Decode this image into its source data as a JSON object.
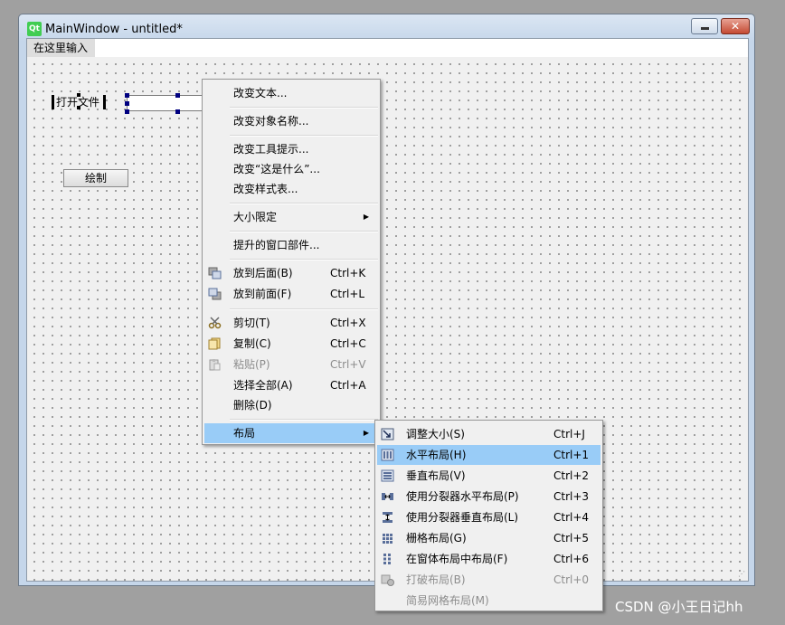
{
  "window": {
    "title": "MainWindow - untitled*",
    "logo_text": "Qt",
    "close_glyph": "✕"
  },
  "menubar": {
    "placeholder": "在这里输入"
  },
  "form": {
    "label_open_file": "打开文件",
    "button_draw": "绘制"
  },
  "context_menu": {
    "items": [
      {
        "label": "改变文本..."
      },
      {
        "label": "改变对象名称..."
      },
      {
        "label": "改变工具提示..."
      },
      {
        "label": "改变“这是什么”..."
      },
      {
        "label": "改变样式表..."
      },
      {
        "label": "大小限定",
        "submenu": true
      },
      {
        "label": "提升的窗口部件..."
      },
      {
        "label": "放到后面(B)",
        "shortcut": "Ctrl+K",
        "icon": "send-to-back-icon"
      },
      {
        "label": "放到前面(F)",
        "shortcut": "Ctrl+L",
        "icon": "bring-to-front-icon"
      },
      {
        "label": "剪切(T)",
        "shortcut": "Ctrl+X",
        "icon": "cut-icon"
      },
      {
        "label": "复制(C)",
        "shortcut": "Ctrl+C",
        "icon": "copy-icon"
      },
      {
        "label": "粘贴(P)",
        "shortcut": "Ctrl+V",
        "icon": "paste-icon",
        "disabled": true
      },
      {
        "label": "选择全部(A)",
        "shortcut": "Ctrl+A"
      },
      {
        "label": "删除(D)"
      },
      {
        "label": "布局",
        "submenu": true,
        "highlighted": true
      }
    ]
  },
  "layout_submenu": {
    "items": [
      {
        "label": "调整大小(S)",
        "shortcut": "Ctrl+J",
        "icon": "adjust-size-icon"
      },
      {
        "label": "水平布局(H)",
        "shortcut": "Ctrl+1",
        "icon": "horizontal-layout-icon",
        "highlighted": true
      },
      {
        "label": "垂直布局(V)",
        "shortcut": "Ctrl+2",
        "icon": "vertical-layout-icon"
      },
      {
        "label": "使用分裂器水平布局(P)",
        "shortcut": "Ctrl+3",
        "icon": "horizontal-splitter-icon"
      },
      {
        "label": "使用分裂器垂直布局(L)",
        "shortcut": "Ctrl+4",
        "icon": "vertical-splitter-icon"
      },
      {
        "label": "栅格布局(G)",
        "shortcut": "Ctrl+5",
        "icon": "grid-layout-icon"
      },
      {
        "label": "在窗体布局中布局(F)",
        "shortcut": "Ctrl+6",
        "icon": "form-layout-icon"
      },
      {
        "label": "打破布局(B)",
        "shortcut": "Ctrl+0",
        "icon": "break-layout-icon",
        "disabled": true
      },
      {
        "label": "简易网格布局(M)",
        "disabled": true
      }
    ]
  },
  "watermark": "CSDN @小王日记hh",
  "colors": {
    "highlight": "#99ccf7",
    "handle": "#000080",
    "qt_green": "#41cd52"
  }
}
